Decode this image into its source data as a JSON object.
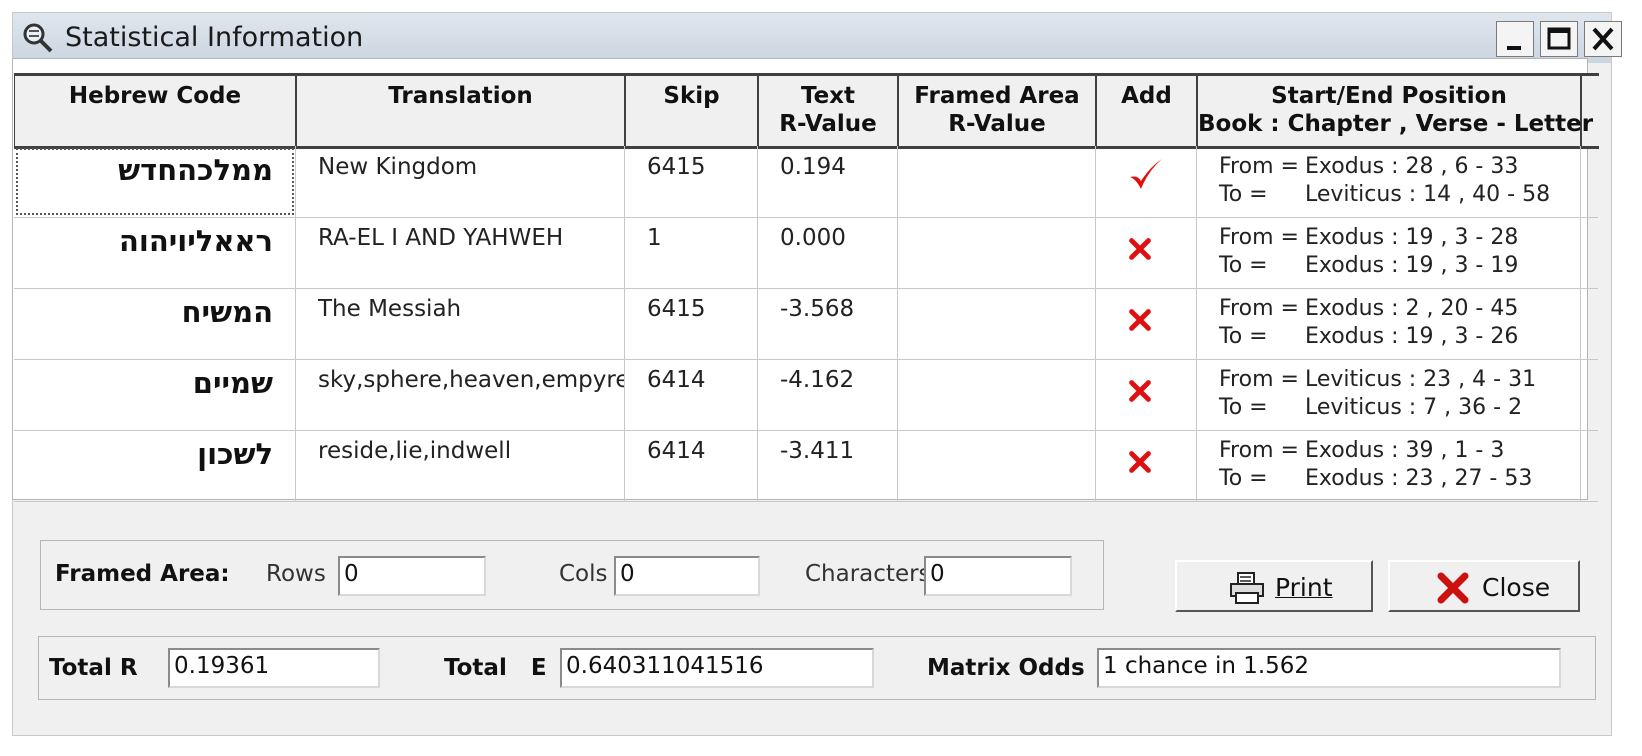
{
  "window": {
    "title": "Statistical Information",
    "icon": "magnifier-icon"
  },
  "table": {
    "headers": {
      "hebrew": "Hebrew Code",
      "translation": "Translation",
      "skip": "Skip",
      "text_r_1": "Text",
      "text_r_2": "R-Value",
      "framed_1": "Framed Area",
      "framed_2": "R-Value",
      "add": "Add",
      "pos_1": "Start/End Position",
      "pos_2": "Book : Chapter , Verse - Letter"
    },
    "rows": [
      {
        "hebrew": "ממלכהחדש",
        "translation": "New Kingdom",
        "skip": "6415",
        "text_r": "0.194",
        "framed_r": "",
        "add": "check",
        "from_label": "From =",
        "from": "Exodus : 28 , 6 - 33",
        "to_label": "To =",
        "to": "Leviticus : 14 , 40 - 58"
      },
      {
        "hebrew": "ראאליויהוה",
        "translation": "RA-EL I AND YAHWEH",
        "skip": "1",
        "text_r": "0.000",
        "framed_r": "",
        "add": "cross",
        "from_label": "From =",
        "from": "Exodus : 19 , 3 - 28",
        "to_label": "To =",
        "to": "Exodus : 19 , 3 - 19"
      },
      {
        "hebrew": "המשיח",
        "translation": "The Messiah",
        "skip": "6415",
        "text_r": "-3.568",
        "framed_r": "",
        "add": "cross",
        "from_label": "From =",
        "from": "Exodus : 2 , 20 - 45",
        "to_label": "To =",
        "to": "Exodus : 19 , 3 - 26"
      },
      {
        "hebrew": "שמיים",
        "translation": "sky,sphere,heaven,empyrean",
        "skip": "6414",
        "text_r": "-4.162",
        "framed_r": "",
        "add": "cross",
        "from_label": "From =",
        "from": "Leviticus : 23 , 4 - 31",
        "to_label": "To =",
        "to": "Leviticus : 7 , 36 - 2"
      },
      {
        "hebrew": "לשכון",
        "translation": "reside,lie,indwell",
        "skip": "6414",
        "text_r": "-3.411",
        "framed_r": "",
        "add": "cross",
        "from_label": "From =",
        "from": "Exodus : 39 , 1 - 3",
        "to_label": "To =",
        "to": "Exodus : 23 , 27 - 53"
      }
    ]
  },
  "framed_area": {
    "label": "Framed Area:",
    "rows_label": "Rows",
    "rows_value": "0",
    "cols_label": "Cols",
    "cols_value": "0",
    "chars_label": "Characters",
    "chars_value": "0"
  },
  "buttons": {
    "print": "Print",
    "close": "Close"
  },
  "totals": {
    "total_r_label": "Total R",
    "total_r_value": "0.19361",
    "total_e_label": "Total   E",
    "total_e_value": "0.640311041516",
    "odds_label": "Matrix Odds",
    "odds_value": "1 chance in 1.562"
  },
  "colors": {
    "accent_red": "#e01010",
    "title_bar": "#cbd5e0"
  }
}
